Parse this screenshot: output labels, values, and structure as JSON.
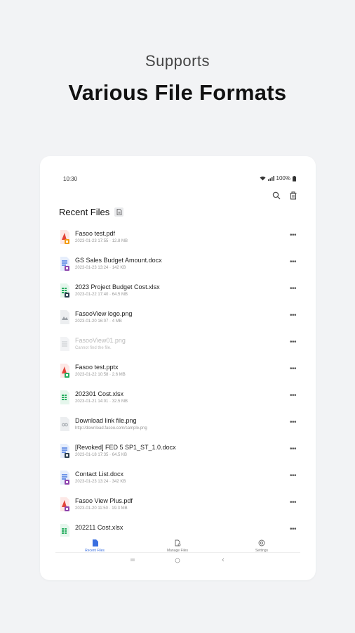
{
  "hero": {
    "subtitle": "Supports",
    "title": "Various File Formats"
  },
  "status_bar": {
    "time": "10:30",
    "battery": "100%"
  },
  "toolbar": {
    "icons": [
      "search-icon",
      "trash-icon"
    ]
  },
  "section": {
    "title": "Recent Files"
  },
  "files": [
    {
      "name": "Fasoo test.pdf",
      "meta": "2023-01-23  17:55  ·  12.8 MB",
      "type": "pdf",
      "color": "#e3453a",
      "badge": "#f39c12",
      "disabled": false
    },
    {
      "name": "GS Sales Budget Amount.docx",
      "meta": "2023-01-23  13:24  ·  142 KB",
      "type": "docx",
      "color": "#3a6fe0",
      "badge": "#8e44ad",
      "disabled": false
    },
    {
      "name": "2023 Project Budget Cost.xlsx",
      "meta": "2023-01-22  17:40  ·  64.5 MB",
      "type": "xlsx",
      "color": "#27ae60",
      "badge": "#2c3e50",
      "disabled": false
    },
    {
      "name": "FasooView logo.png",
      "meta": "2023-01-20  16:07  ·  4 MB",
      "type": "png",
      "color": "#9aa0a6",
      "badge": "",
      "disabled": false
    },
    {
      "name": "FasooView01.png",
      "meta": "Cannot find the file.",
      "type": "file",
      "color": "#c9ccd0",
      "badge": "",
      "disabled": true
    },
    {
      "name": "Fasoo test.pptx",
      "meta": "2023-01-22  10:58  ·  2.6 MB",
      "type": "pptx",
      "color": "#e3453a",
      "badge": "#27ae60",
      "disabled": false
    },
    {
      "name": "202301 Cost.xlsx",
      "meta": "2023-01-21  14:01  ·  32.5 MB",
      "type": "xlsx",
      "color": "#27ae60",
      "badge": "",
      "disabled": false
    },
    {
      "name": "Download link file.png",
      "meta": "http://download.fasoo.com/sample.png",
      "type": "link",
      "color": "#9aa0a6",
      "badge": "",
      "disabled": false
    },
    {
      "name": "[Revoked] FED 5 SP1_ST_1.0.docx",
      "meta": "2023-01-18  17:35  ·  64.5 KB",
      "type": "docx",
      "color": "#3a6fe0",
      "badge": "#2c3e50",
      "disabled": false
    },
    {
      "name": "Contact List.docx",
      "meta": "2023-01-23  13:24  ·  342 KB",
      "type": "docx",
      "color": "#3a6fe0",
      "badge": "#8e44ad",
      "disabled": false
    },
    {
      "name": "Fasoo View Plus.pdf",
      "meta": "2023-01-20  11:50  ·  19.3 MB",
      "type": "pdf",
      "color": "#e3453a",
      "badge": "#8e44ad",
      "disabled": false
    },
    {
      "name": "202211 Cost.xlsx",
      "meta": "",
      "type": "xlsx",
      "color": "#27ae60",
      "badge": "",
      "disabled": false
    }
  ],
  "more_label": "•••",
  "bottom_nav": [
    {
      "label": "Recent Files",
      "icon": "file-icon",
      "active": true
    },
    {
      "label": "Manage Files",
      "icon": "folder-icon",
      "active": false
    },
    {
      "label": "Settings",
      "icon": "gear-icon",
      "active": false
    }
  ],
  "accent_color": "#3a6fe0"
}
